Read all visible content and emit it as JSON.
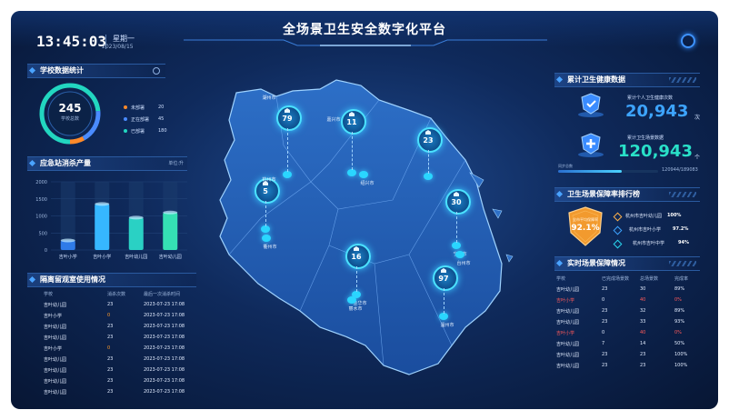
{
  "header": {
    "title": "全场景卫生安全数字化平台",
    "time": "13:45:03",
    "weekday": "星期一",
    "date": "2023/08/15"
  },
  "school_stats": {
    "title": "学校数据统计",
    "total": "245",
    "total_label": "学校总数",
    "legend": [
      {
        "label": "未部署",
        "value": "20",
        "color": "#ff8a2a"
      },
      {
        "label": "正在部署",
        "value": "45",
        "color": "#4a8bff"
      },
      {
        "label": "已部署",
        "value": "180",
        "color": "#22d6c0"
      }
    ]
  },
  "emergency": {
    "title": "应急站消杀产量",
    "unit": "单位:升",
    "chart_data": {
      "type": "bar",
      "categories": [
        "吉叶小学",
        "吉叶小学",
        "吉叶幼儿园",
        "吉叶幼儿园"
      ],
      "values": [
        280,
        1350,
        950,
        1100
      ],
      "ylim": [
        0,
        2000
      ],
      "yticks": [
        "2000",
        "1500",
        "1000",
        "500",
        "0"
      ]
    }
  },
  "isolation": {
    "title": "隔离留观室使用情况",
    "columns": [
      "学校",
      "消杀次数",
      "最后一次消杀时间"
    ],
    "rows": [
      {
        "school": "吉叶幼儿园",
        "count": "23",
        "time": "2023-07-23 17:08",
        "style": ""
      },
      {
        "school": "吉叶小学",
        "count": "0",
        "time": "2023-07-23 17:08",
        "style": "warn"
      },
      {
        "school": "吉叶幼儿园",
        "count": "23",
        "time": "2023-07-23 17:08",
        "style": ""
      },
      {
        "school": "吉叶幼儿园",
        "count": "23",
        "time": "2023-07-23 17:08",
        "style": ""
      },
      {
        "school": "吉叶小学",
        "count": "0",
        "time": "2023-07-23 17:08",
        "style": "warn"
      },
      {
        "school": "吉叶幼儿园",
        "count": "23",
        "time": "2023-07-23 17:08",
        "style": ""
      },
      {
        "school": "吉叶幼儿园",
        "count": "23",
        "time": "2023-07-23 17:08",
        "style": ""
      },
      {
        "school": "吉叶幼儿园",
        "count": "23",
        "time": "2023-07-23 17:08",
        "style": ""
      },
      {
        "school": "吉叶幼儿园",
        "count": "23",
        "time": "2023-07-23 17:08",
        "style": ""
      }
    ]
  },
  "map": {
    "cities": [
      {
        "name": "湖州市",
        "count": "79"
      },
      {
        "name": "嘉兴市",
        "count": "11"
      },
      {
        "name": "",
        "count": "23"
      },
      {
        "name": "杭州市",
        "count": "5"
      },
      {
        "name": "绍兴市",
        "count": ""
      },
      {
        "name": "宁波市",
        "count": "30"
      },
      {
        "name": "衢州市",
        "count": ""
      },
      {
        "name": "金华市",
        "count": "16"
      },
      {
        "name": "台州市",
        "count": ""
      },
      {
        "name": "丽水市",
        "count": ""
      },
      {
        "name": "温州市",
        "count": "97"
      }
    ]
  },
  "health": {
    "title": "累计卫生健康数据",
    "personal_label": "累计个人卫生健康次数",
    "personal_value": "20,943",
    "personal_unit": "次",
    "scene_label": "累计卫生场景数据",
    "scene_value": "120,943",
    "scene_unit": "个",
    "progress_label": "同步总数",
    "progress_text": "120944/189083",
    "progress": 0.64
  },
  "ranking": {
    "title": "卫生场景保障率排行榜",
    "badge_label": "全市平均保障率",
    "badge_value": "92.1%",
    "items": [
      {
        "name": "杭州市吉叶幼儿园",
        "value": "100%"
      },
      {
        "name": "杭州市吉叶小学",
        "value": "97.2%"
      },
      {
        "name": "杭州市吉叶中学",
        "value": "94%"
      }
    ]
  },
  "realtime": {
    "title": "实时场景保障情况",
    "columns": [
      "学校",
      "已完成场景数",
      "总场景数",
      "完成率"
    ],
    "rows": [
      {
        "school": "吉叶幼儿园",
        "done": "23",
        "total": "30",
        "rate": "89%",
        "style": ""
      },
      {
        "school": "吉叶小学",
        "done": "0",
        "total": "40",
        "rate": "0%",
        "style": "warn"
      },
      {
        "school": "吉叶幼儿园",
        "done": "23",
        "total": "32",
        "rate": "89%",
        "style": ""
      },
      {
        "school": "吉叶幼儿园",
        "done": "23",
        "total": "33",
        "rate": "93%",
        "style": ""
      },
      {
        "school": "吉叶小学",
        "done": "0",
        "total": "40",
        "rate": "0%",
        "style": "warn"
      },
      {
        "school": "吉叶幼儿园",
        "done": "7",
        "total": "14",
        "rate": "50%",
        "style": ""
      },
      {
        "school": "吉叶幼儿园",
        "done": "23",
        "total": "23",
        "rate": "100%",
        "style": ""
      },
      {
        "school": "吉叶幼儿园",
        "done": "23",
        "total": "23",
        "rate": "100%",
        "style": ""
      }
    ]
  }
}
